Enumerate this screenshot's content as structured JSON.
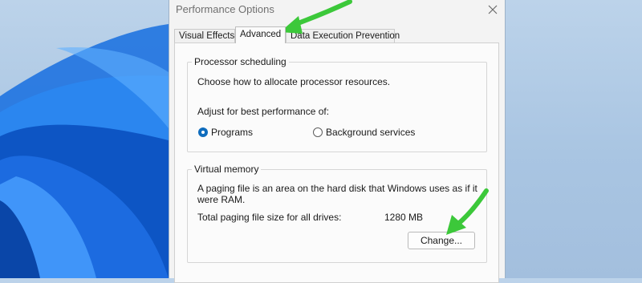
{
  "window": {
    "title": "Performance Options",
    "close_icon": "close-icon"
  },
  "tabs": [
    {
      "label": "Visual Effects",
      "active": false
    },
    {
      "label": "Advanced",
      "active": true
    },
    {
      "label": "Data Execution Prevention",
      "active": false
    }
  ],
  "processor_scheduling": {
    "legend": "Processor scheduling",
    "description": "Choose how to allocate processor resources.",
    "adjust_label": "Adjust for best performance of:",
    "options": [
      {
        "label": "Programs",
        "selected": true
      },
      {
        "label": "Background services",
        "selected": false
      }
    ]
  },
  "virtual_memory": {
    "legend": "Virtual memory",
    "description_line1": "A paging file is an area on the hard disk that Windows uses as if it",
    "description_line2": "were RAM.",
    "total_label": "Total paging file size for all drives:",
    "total_value": "1280 MB",
    "change_button": "Change..."
  },
  "annotations": {
    "arrow_color": "#3cc83a",
    "arrows": [
      "pointer-arrow-to-advanced-tab",
      "pointer-arrow-to-change-button"
    ]
  },
  "colors": {
    "accent": "#0f6cbd",
    "dialog_bg": "#f3f3f3",
    "wallpaper_blue": "#1a6fd6"
  }
}
